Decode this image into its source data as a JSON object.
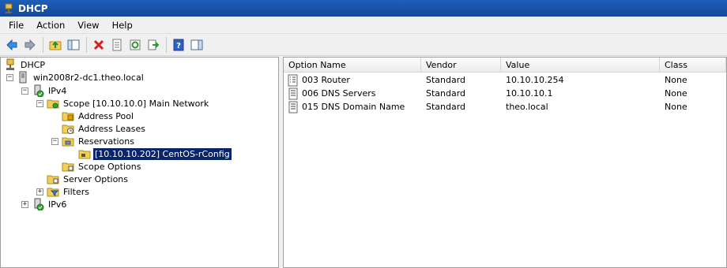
{
  "window": {
    "title": "DHCP"
  },
  "menu": {
    "items": [
      "File",
      "Action",
      "View",
      "Help"
    ]
  },
  "toolbar": {
    "buttons": [
      "back-icon",
      "forward-icon",
      "up-folder-icon",
      "show-hide-tree-icon",
      "delete-icon",
      "properties-icon",
      "refresh-icon",
      "export-icon",
      "help-icon",
      "action-pane-icon"
    ]
  },
  "tree": {
    "root": "DHCP",
    "server": "win2008r2-dc1.theo.local",
    "ipv4": "IPv4",
    "scope": "Scope [10.10.10.0] Main Network",
    "address_pool": "Address Pool",
    "address_leases": "Address Leases",
    "reservations": "Reservations",
    "reservation_item": "[10.10.10.202] CentOS-rConfig",
    "scope_options": "Scope Options",
    "server_options": "Server Options",
    "filters": "Filters",
    "ipv6": "IPv6"
  },
  "list": {
    "columns": [
      "Option Name",
      "Vendor",
      "Value",
      "Class"
    ],
    "rows": [
      {
        "name": "003 Router",
        "vendor": "Standard",
        "value": "10.10.10.254",
        "class": "None"
      },
      {
        "name": "006 DNS Servers",
        "vendor": "Standard",
        "value": "10.10.10.1",
        "class": "None"
      },
      {
        "name": "015 DNS Domain Name",
        "vendor": "Standard",
        "value": "theo.local",
        "class": "None"
      }
    ]
  },
  "colors": {
    "title_bar": "#1a54a8",
    "selection": "#0a246a"
  }
}
